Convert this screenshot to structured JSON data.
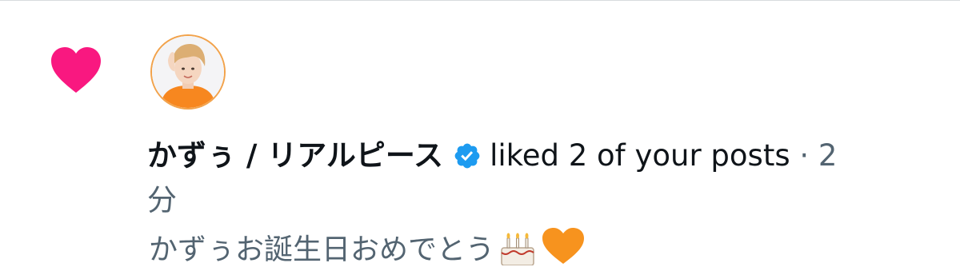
{
  "notification": {
    "type_icon": "heart-icon",
    "type_color": "#f91880",
    "avatar": "profile-photo-icon",
    "user_name": "かずぅ / リアルピース",
    "verified_badge": "verified-icon",
    "verified_color": "#1d9bf0",
    "action_text": "liked 2 of your posts",
    "separator": "·",
    "time_number": "2",
    "time_unit": "分",
    "preview_text": "かずぅお誕生日おめでとう",
    "preview_emojis": [
      "birthday-cake-icon",
      "orange-heart-icon"
    ]
  }
}
